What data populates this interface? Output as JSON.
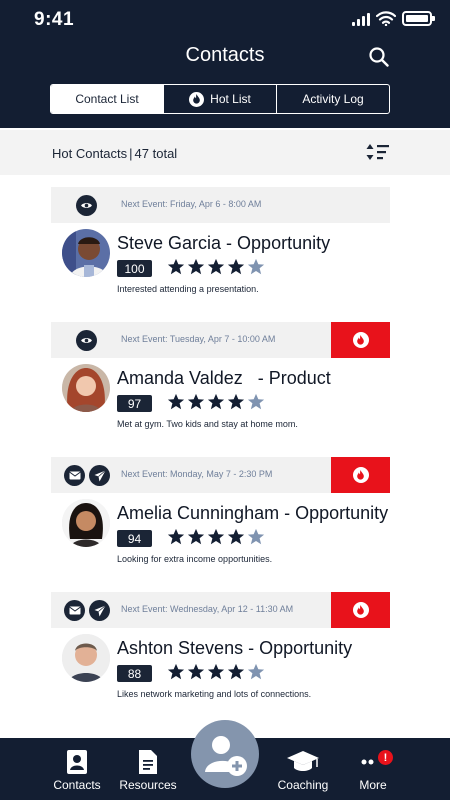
{
  "status_bar": {
    "time": "9:41"
  },
  "header": {
    "title": "Contacts"
  },
  "tabs": [
    {
      "label": "Contact List",
      "active": true
    },
    {
      "label": "Hot List",
      "active": false,
      "icon": "flame-icon"
    },
    {
      "label": "Activity Log",
      "active": false
    }
  ],
  "summary": {
    "label": "Hot Contacts",
    "separator": "|",
    "count": "47 total"
  },
  "contacts": [
    {
      "next_event": "Next Event: Friday, Apr 6 - 8:00 AM",
      "name": "Steve Garcia",
      "type": " - Opportunity",
      "score": "100",
      "rating": 4,
      "note": "Interested attending a presentation.",
      "hot": false,
      "actions": [
        "eye-icon"
      ]
    },
    {
      "next_event": "Next Event: Tuesday, Apr 7 - 10:00 AM",
      "name": "Amanda Valdez",
      "type": "   - Product",
      "score": "97",
      "rating": 4,
      "note": "Met at gym. Two kids and stay at home mom.",
      "hot": true,
      "actions": [
        "eye-icon"
      ]
    },
    {
      "next_event": "Next Event: Monday, May 7 - 2:30 PM",
      "name": "Amelia Cunningham",
      "type": " - Opportunity",
      "score": "94",
      "rating": 4,
      "note": "Looking for extra income opportunities.",
      "hot": true,
      "actions": [
        "mail-icon",
        "send-icon"
      ]
    },
    {
      "next_event": "Next Event: Wednesday, Apr 12 - 11:30 AM",
      "name": "Ashton Stevens",
      "type": " - Opportunity",
      "score": "88",
      "rating": 4,
      "note": "Likes network marketing and lots of connections.",
      "hot": true,
      "actions": [
        "mail-icon",
        "send-icon"
      ]
    }
  ],
  "tabbar": {
    "contacts": "Contacts",
    "resources": "Resources",
    "coaching": "Coaching",
    "more": "More",
    "more_badge": "!"
  },
  "colors": {
    "navy": "#131e32",
    "hot_red": "#e8121b",
    "muted_star": "#7f93b0",
    "fab": "#8495ad"
  }
}
